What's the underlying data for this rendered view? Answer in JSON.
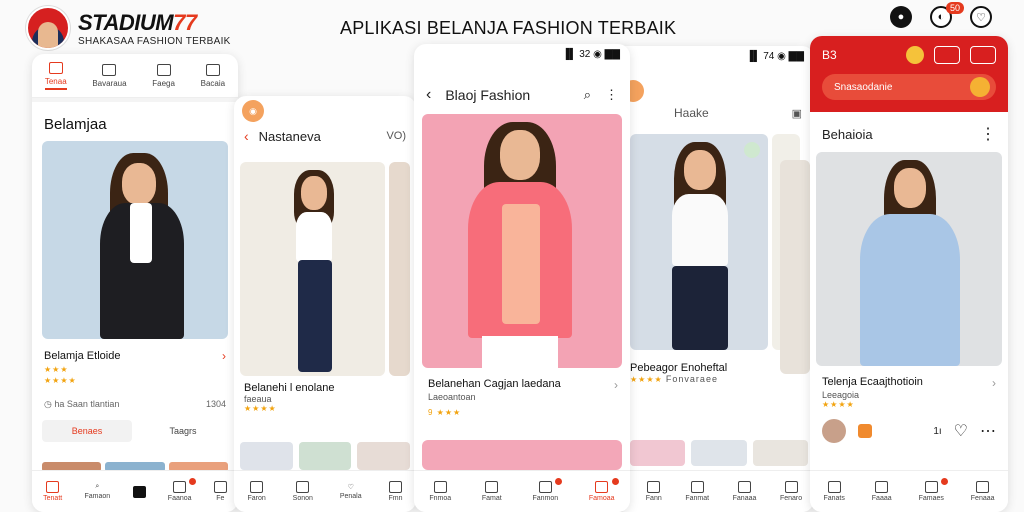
{
  "brand": {
    "title_main": "STADIUM",
    "title_accent": "77",
    "subtitle": "SHAKASAA FASHION TERBAIK"
  },
  "headline": "APLIKASI BELANJA FASHION TERBAIK",
  "top_icons": {
    "badge": "50"
  },
  "phone1": {
    "tabs": [
      "Tenaa",
      "Bavaraua",
      "Faega",
      "Bacaia"
    ],
    "section_title": "Belamjaa",
    "product_name": "Belamja Etloide",
    "meta_left": "ha Saan tlantian",
    "meta_right": "1304",
    "btn_primary": "Benaes",
    "btn_ghost": "Taagrs",
    "bottom": [
      "Tenatt",
      "Famaon",
      "",
      "Faanoa",
      "Fe"
    ]
  },
  "phone2": {
    "header_title": "Nastaneva",
    "header_right": "VO)",
    "product_name": "Belanehi l enolane",
    "product_sub": "faeaua",
    "bottom": [
      "Faron",
      "Sonon",
      "Penala",
      "Fmn"
    ]
  },
  "phone3": {
    "statusbar": "▐▌ 32 ◉ ▇▇",
    "header_title": "Blaoj Fashion",
    "product_name": "Belanehan Cagjan laedana",
    "product_sub": "Laeoantoan",
    "rating": "9 ★★★",
    "bottom": [
      "Fnmoa",
      "Famat",
      "Fanmon",
      "Famoaa"
    ]
  },
  "phone4": {
    "statusbar": "▐▌ 74 ◉ ▇▇",
    "header_title": "Haake",
    "product_name": "Pebeagor Enoheftal",
    "product_sub": "Fonvaraee",
    "bottom": [
      "Fann",
      "Fanmat",
      "Fanaaa",
      "Fenaro"
    ]
  },
  "phone5": {
    "top_title": "B3",
    "search_text": "Snasaodanie",
    "section_title": "Behaioia",
    "product_name": "Telenja Ecaajthotioin",
    "product_sub": "Leeagoia",
    "count": "1ı",
    "bottom": [
      "Fanats",
      "Faaaa",
      "Famaes",
      "Fenaaa"
    ]
  },
  "colors": {
    "accent": "#e53a1e",
    "star": "#f2a30f"
  }
}
